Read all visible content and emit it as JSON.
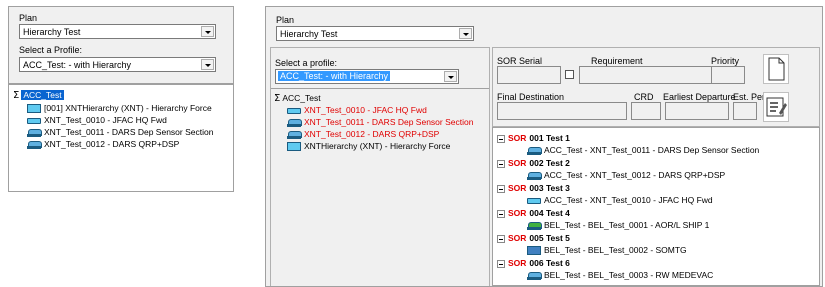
{
  "left": {
    "plan_label": "Plan",
    "plan_value": "Hierarchy Test",
    "profile_label": "Select a Profile:",
    "profile_value": "ACC_Test: - with Hierarchy",
    "tree": {
      "root": "ACC_Test",
      "items": [
        "[001] XNTHierarchy (XNT) - Hierarchy Force",
        "XNT_Test_0010 - JFAC HQ Fwd",
        "XNT_Test_0011 - DARS Dep Sensor Section",
        "XNT_Test_0012 - DARS QRP+DSP"
      ]
    }
  },
  "right": {
    "plan_label": "Plan",
    "plan_value": "Hierarchy Test",
    "profile_label": "Select a profile:",
    "profile_value": "ACC_Test: - with Hierarchy",
    "tree": {
      "root": "ACC_Test",
      "items": [
        "XNT_Test_0010 - JFAC HQ Fwd",
        "XNT_Test_0011 - DARS Dep Sensor Section",
        "XNT_Test_0012 - DARS QRP+DSP",
        "XNTHierarchy (XNT) - Hierarchy Force"
      ]
    },
    "form": {
      "sor_serial": "SOR Serial",
      "requirement": "Requirement",
      "priority": "Priority",
      "final_destination": "Final Destination",
      "crd": "CRD",
      "earliest_departure": "Earliest Departure",
      "est_pers": "Est. Pers."
    },
    "sors": [
      {
        "tag": "SOR",
        "title": "001 Test 1",
        "child": "ACC_Test - XNT_Test_0011 - DARS Dep Sensor Section"
      },
      {
        "tag": "SOR",
        "title": "002 Test 2",
        "child": "ACC_Test - XNT_Test_0012 - DARS QRP+DSP"
      },
      {
        "tag": "SOR",
        "title": "003 Test 3",
        "child": "ACC_Test - XNT_Test_0010 - JFAC HQ Fwd"
      },
      {
        "tag": "SOR",
        "title": "004 Test 4",
        "child": "BEL_Test - BEL_Test_0001 - AOR/L SHIP 1"
      },
      {
        "tag": "SOR",
        "title": "005 Test 5",
        "child": "BEL_Test - BEL_Test_0002 - SOMTG"
      },
      {
        "tag": "SOR",
        "title": "006 Test 6",
        "child": "BEL_Test - BEL_Test_0003 - RW MEDEVAC"
      }
    ]
  }
}
